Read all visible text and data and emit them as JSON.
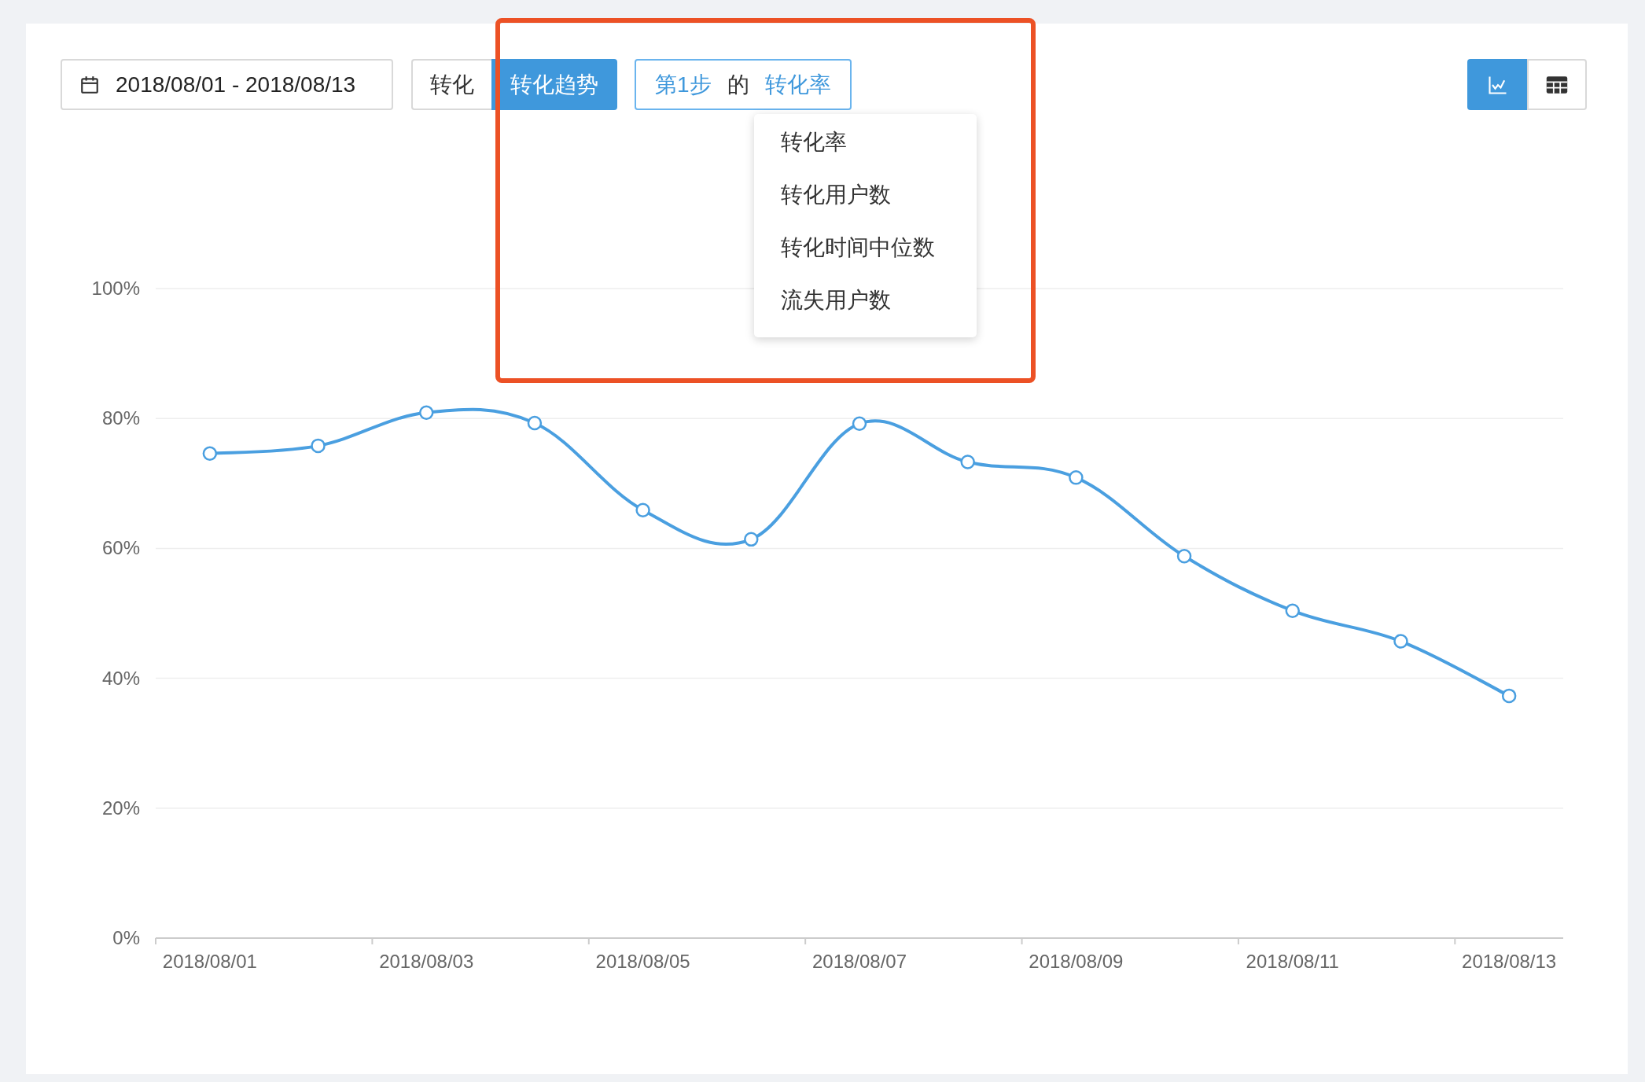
{
  "date_range": "2018/08/01 - 2018/08/13",
  "view_modes": [
    {
      "label": "转化",
      "selected": false
    },
    {
      "label": "转化趋势",
      "selected": true
    }
  ],
  "metric_selector": {
    "step": "第1步",
    "connector": "的",
    "metric": "转化率"
  },
  "metric_menu": {
    "items": [
      "转化率",
      "转化用户数",
      "转化时间中位数",
      "流失用户数"
    ]
  },
  "display_toggle": [
    {
      "kind": "chart",
      "selected": true
    },
    {
      "kind": "table",
      "selected": false
    }
  ],
  "chart": {
    "chart_data": {
      "type": "line",
      "categories": [
        "2018/08/01",
        null,
        "2018/08/03",
        null,
        "2018/08/05",
        null,
        "2018/08/07",
        null,
        "2018/08/09",
        null,
        "2018/08/11",
        null,
        "2018/08/13"
      ],
      "grid": true,
      "series": [
        {
          "color": "#4a9fe0",
          "marker": "circle",
          "values": [
            74.6,
            75.8,
            80.9,
            79.3,
            65.9,
            61.4,
            79.2,
            73.3,
            70.9,
            58.8,
            50.4,
            45.7,
            37.3
          ]
        }
      ],
      "ylim": [
        0,
        100
      ],
      "yticks": [
        {
          "value": 0,
          "label": "0%"
        },
        {
          "value": 20,
          "label": "20%"
        },
        {
          "value": 40,
          "label": "40%"
        },
        {
          "value": 60,
          "label": "60%"
        },
        {
          "value": 80,
          "label": "80%"
        },
        {
          "value": 100,
          "label": "100%"
        }
      ]
    }
  }
}
